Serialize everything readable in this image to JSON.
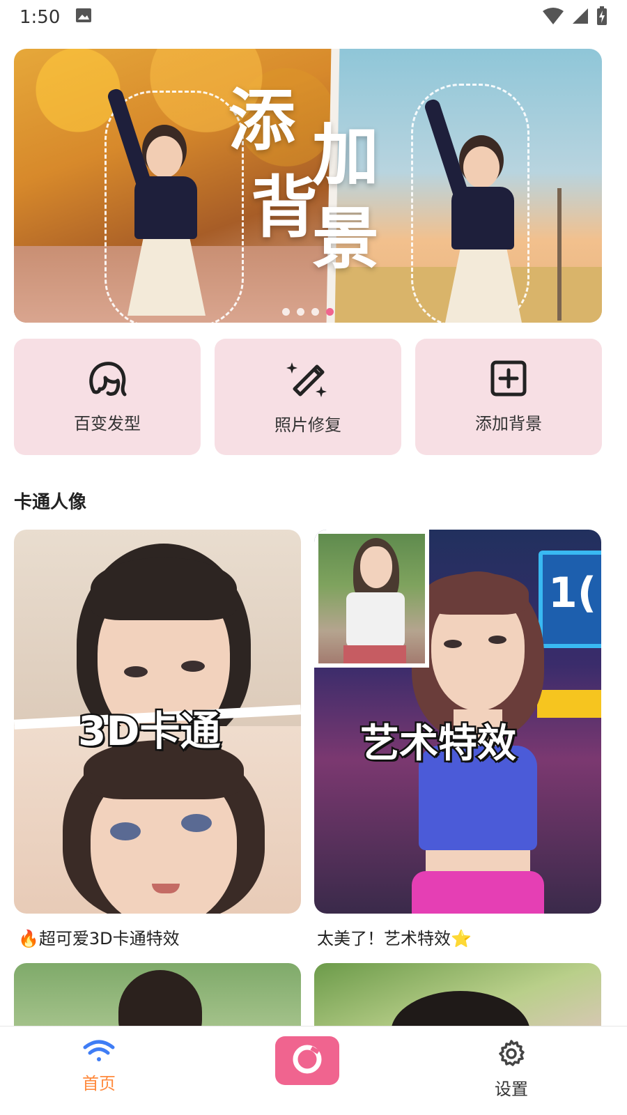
{
  "status_bar": {
    "time": "1:50",
    "icons": [
      "image-icon",
      "wifi-icon",
      "cellular-signal-icon",
      "battery-charging-icon"
    ]
  },
  "banner": {
    "title_line1_a": "添",
    "title_line1_b": "加",
    "title_line2_a": "背",
    "title_line2_b": "景",
    "page_count": 4,
    "active_index": 3
  },
  "tools": [
    {
      "label": "百变发型",
      "icon": "hairstyle-icon"
    },
    {
      "label": "照片修复",
      "icon": "magic-wand-icon"
    },
    {
      "label": "添加背景",
      "icon": "add-square-icon"
    }
  ],
  "section": {
    "title": "卡通人像"
  },
  "cards": [
    {
      "overlay": "3D卡通",
      "caption": "🔥超可爱3D卡通特效"
    },
    {
      "overlay": "艺术特效",
      "caption": "太美了！艺术特效⭐",
      "sign_text": "1("
    }
  ],
  "bottom_nav": {
    "home_label": "首页",
    "settings_label": "设置"
  },
  "colors": {
    "accent_pink": "#f0648f",
    "tool_bg": "#f7dfe4",
    "nav_active": "#ff8a3d",
    "nav_icon_blue": "#3f7df5"
  }
}
